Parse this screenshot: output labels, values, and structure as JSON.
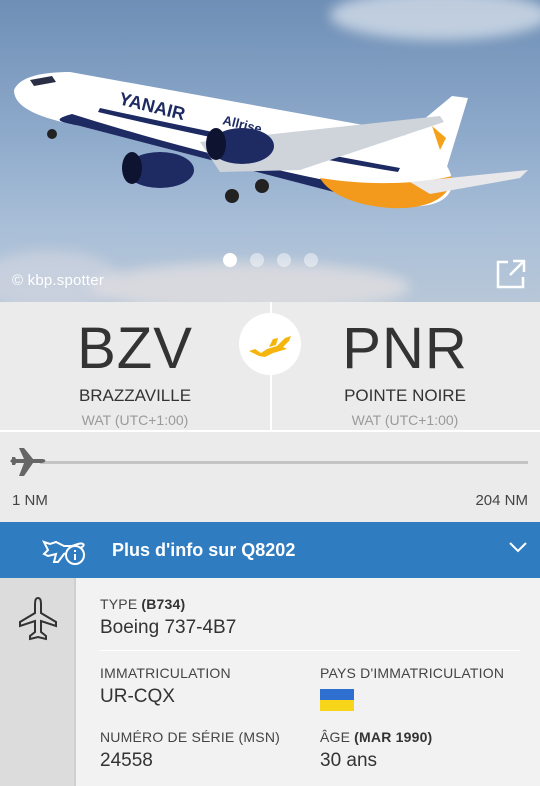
{
  "photo": {
    "credit": "© kbp.spotter",
    "slides_total": 4,
    "slide_active": 1
  },
  "route": {
    "origin": {
      "code": "BZV",
      "city": "BRAZZAVILLE",
      "tz": "WAT (UTC+1:00)"
    },
    "destination": {
      "code": "PNR",
      "city": "POINTE NOIRE",
      "tz": "WAT (UTC+1:00)"
    },
    "accent_color": "#f5b50c"
  },
  "progress": {
    "flown": "1 NM",
    "remaining": "204 NM"
  },
  "info_bar": {
    "label": "Plus d'info sur Q8202",
    "color": "#2f7cc0"
  },
  "aircraft": {
    "type_label": "TYPE",
    "type_code": "(B734)",
    "type_value": "Boeing 737-4B7",
    "reg_label": "IMMATRICULATION",
    "reg_value": "UR-CQX",
    "country_label": "PAYS D'IMMATRICULATION",
    "country_flag": {
      "top": "#2f6fd0",
      "bottom": "#f7d51a"
    },
    "msn_label": "NUMÉRO DE SÉRIE (MSN)",
    "msn_value": "24558",
    "age_label": "ÂGE",
    "age_date": "(MAR 1990)",
    "age_value": "30 ans"
  }
}
